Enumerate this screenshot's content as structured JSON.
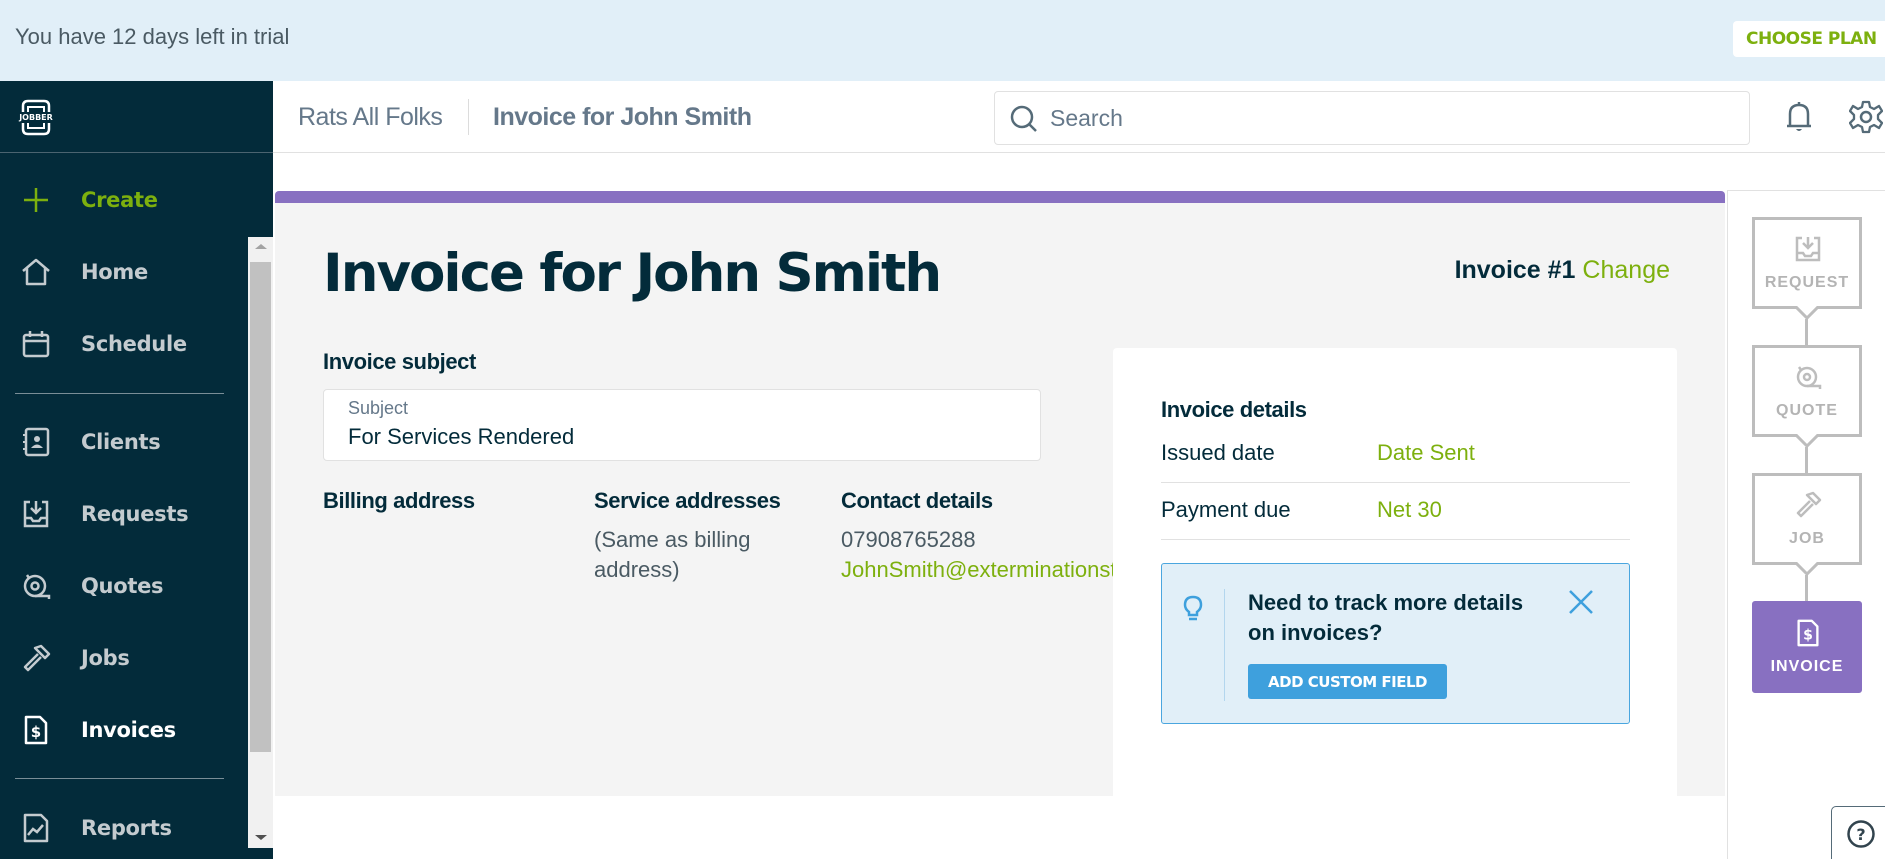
{
  "banner": {
    "trial_text": "You have 12 days left in trial",
    "choose_plan_label": "CHOOSE PLAN"
  },
  "sidebar": {
    "logo_text": "JOBBER",
    "items": [
      {
        "label": "Create",
        "icon": "plus-icon"
      },
      {
        "label": "Home",
        "icon": "home-icon"
      },
      {
        "label": "Schedule",
        "icon": "calendar-icon"
      },
      {
        "label": "Clients",
        "icon": "clients-icon"
      },
      {
        "label": "Requests",
        "icon": "request-inbox-icon"
      },
      {
        "label": "Quotes",
        "icon": "quote-tape-icon"
      },
      {
        "label": "Jobs",
        "icon": "hammer-icon"
      },
      {
        "label": "Invoices",
        "icon": "invoice-icon",
        "active": true
      },
      {
        "label": "Reports",
        "icon": "reports-icon"
      }
    ]
  },
  "header": {
    "company": "Rats All Folks",
    "page": "Invoice for John Smith",
    "search_placeholder": "Search"
  },
  "main": {
    "title": "Invoice for John Smith",
    "invoice_number": "Invoice #1",
    "change_label": "Change",
    "subject_section_label": "Invoice subject",
    "subject_field_label": "Subject",
    "subject_value": "For Services Rendered",
    "billing_heading": "Billing address",
    "service_heading": "Service addresses",
    "service_text": "(Same as billing address)",
    "contact_heading": "Contact details",
    "phone": "07908765288",
    "email": "JohnSmith@exterminationstation.com",
    "accent_color": "#8870c1",
    "link_color": "#7db00e"
  },
  "details": {
    "title": "Invoice details",
    "rows": [
      {
        "label": "Issued date",
        "value": "Date Sent"
      },
      {
        "label": "Payment due",
        "value": "Net 30"
      }
    ],
    "callout": {
      "message": "Need to track more details on invoices?",
      "button_label": "ADD CUSTOM FIELD"
    }
  },
  "workflow": {
    "steps": [
      {
        "label": "REQUEST",
        "icon": "request-inbox-icon"
      },
      {
        "label": "QUOTE",
        "icon": "quote-tape-icon"
      },
      {
        "label": "JOB",
        "icon": "hammer-icon"
      },
      {
        "label": "INVOICE",
        "icon": "invoice-icon",
        "current": true
      }
    ]
  },
  "help": {
    "icon": "help-icon"
  }
}
